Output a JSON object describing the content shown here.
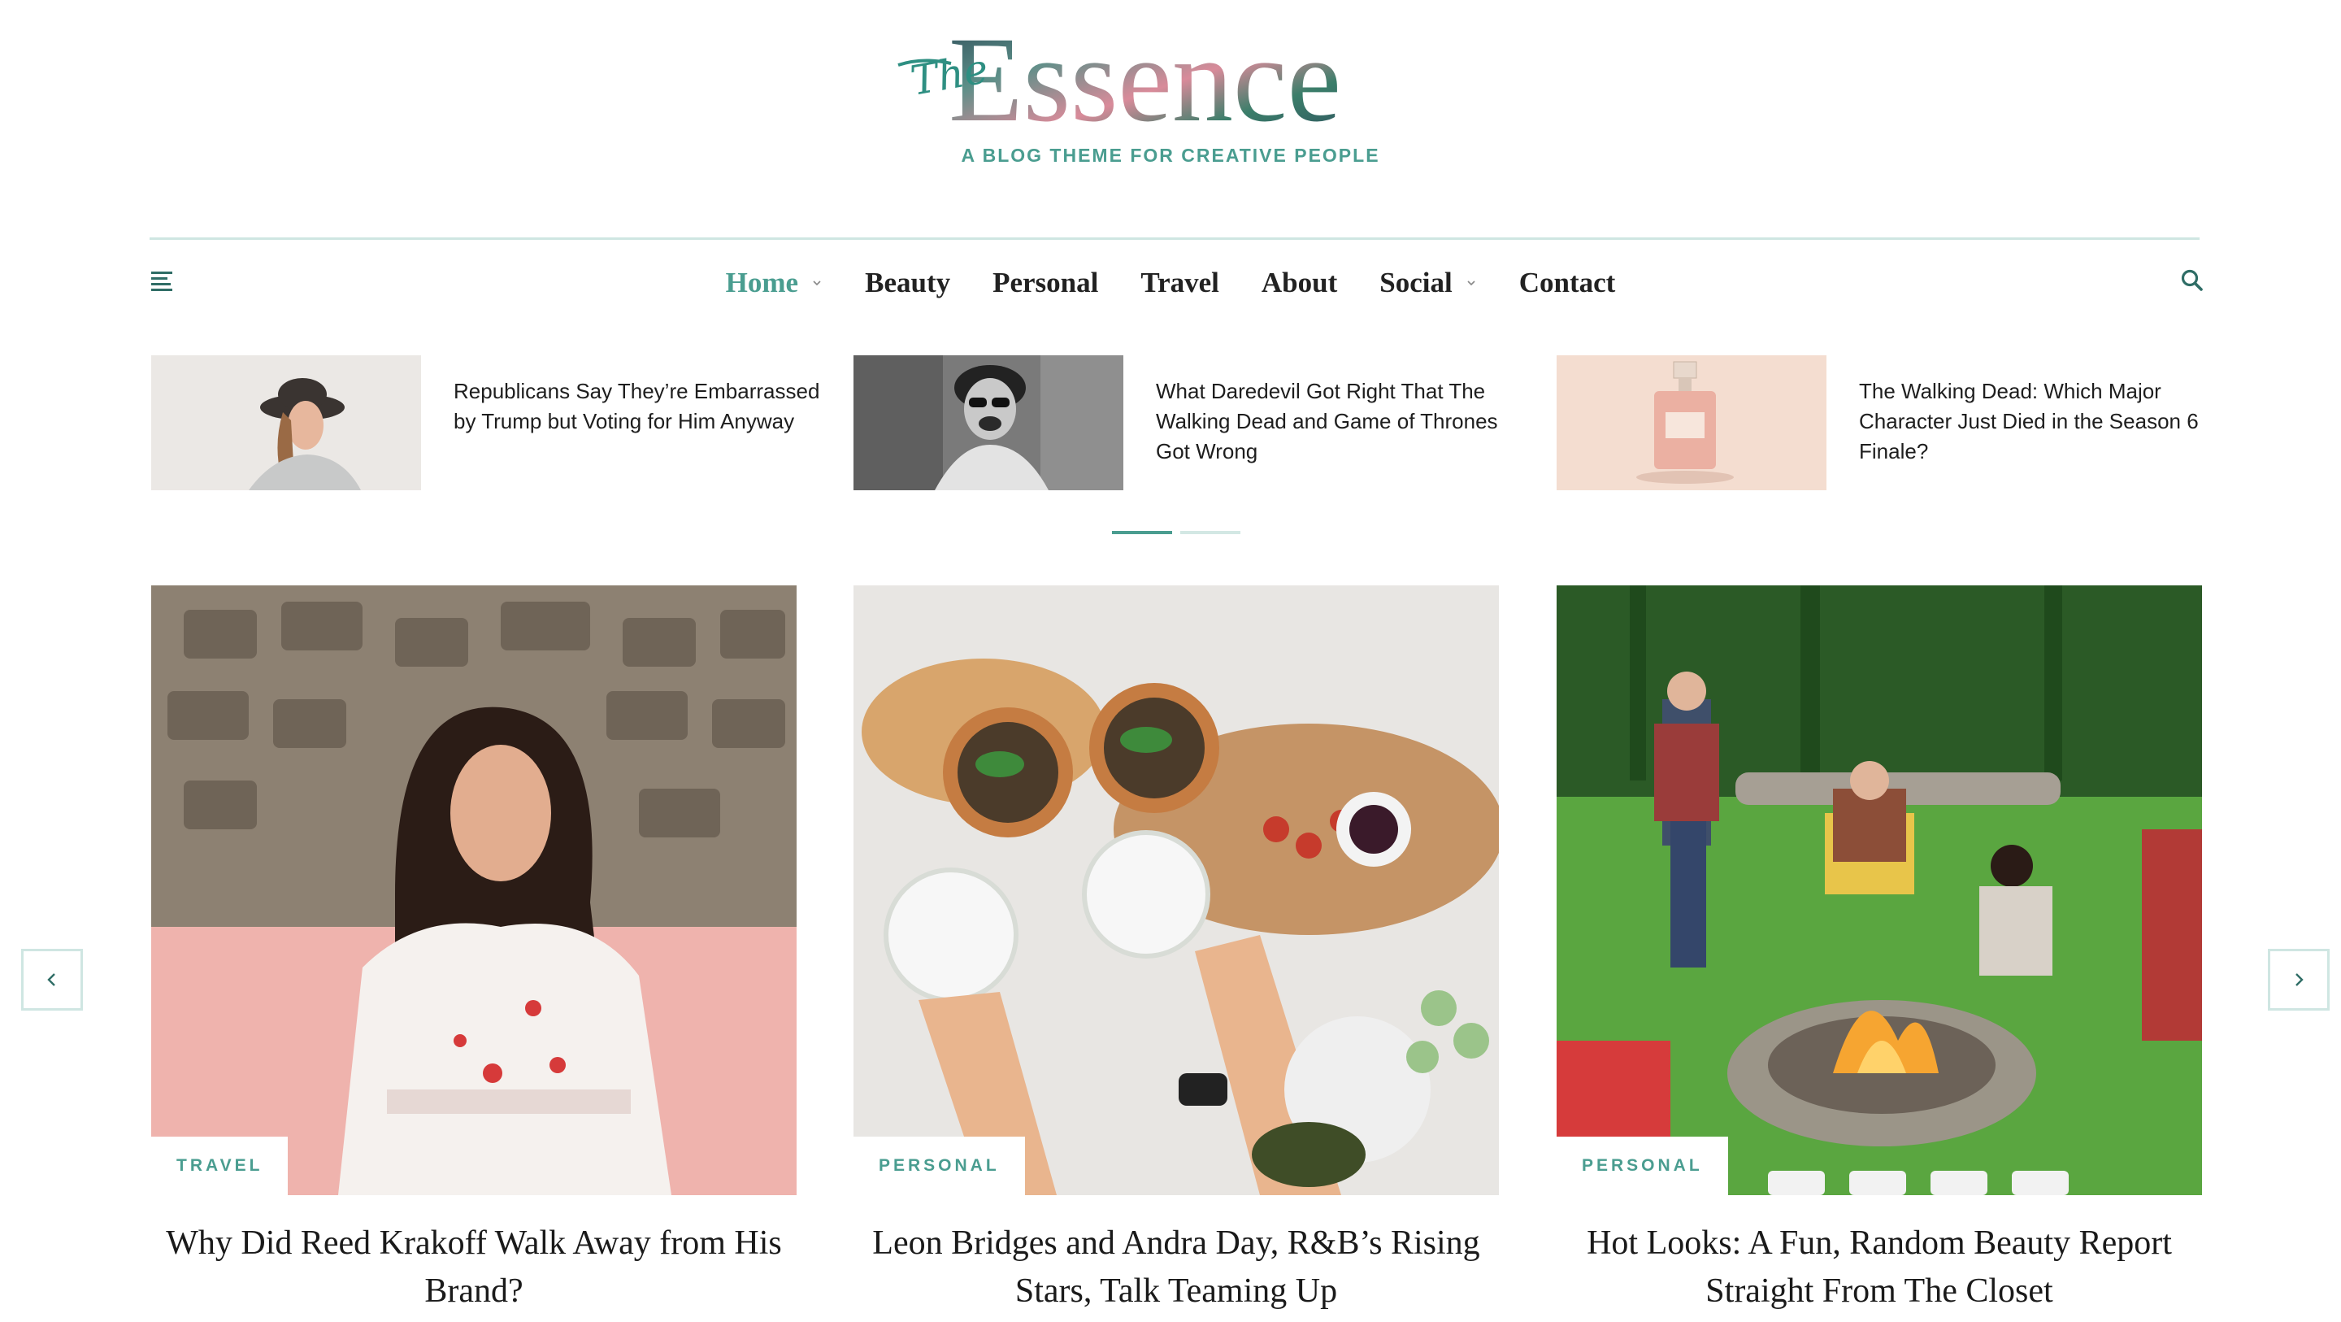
{
  "brand": {
    "logo_the": "The",
    "logo_main": "Essence",
    "tagline": "A BLOG THEME FOR CREATIVE PEOPLE",
    "accent_color": "#4a9d90"
  },
  "nav": {
    "items": [
      {
        "label": "Home",
        "active": true,
        "has_dropdown": true
      },
      {
        "label": "Beauty",
        "active": false,
        "has_dropdown": false
      },
      {
        "label": "Personal",
        "active": false,
        "has_dropdown": false
      },
      {
        "label": "Travel",
        "active": false,
        "has_dropdown": false
      },
      {
        "label": "About",
        "active": false,
        "has_dropdown": false
      },
      {
        "label": "Social",
        "active": false,
        "has_dropdown": true
      },
      {
        "label": "Contact",
        "active": false,
        "has_dropdown": false
      }
    ],
    "menu_icon": "hamburger-icon",
    "search_icon": "search-icon"
  },
  "featured_strip": [
    {
      "title": "Republicans Say They’re Embarrassed by Trump but Voting for Him Anyway",
      "image": "woman-hat-photo"
    },
    {
      "title": "What Daredevil Got Right That The Walking Dead and Game of Thrones Got Wrong",
      "image": "laughing-woman-photo"
    },
    {
      "title": "The Walking Dead: Which Major Character Just Died in the Season 6 Finale?",
      "image": "perfume-bottle-photo"
    }
  ],
  "carousel": {
    "dots": [
      {
        "active": true
      },
      {
        "active": false
      }
    ],
    "prev_icon": "chevron-left-icon",
    "next_icon": "chevron-right-icon"
  },
  "cards": [
    {
      "category": "TRAVEL",
      "title": "Why Did Reed Krakoff Walk Away from His Brand?",
      "image": "woman-floral-dress-photo"
    },
    {
      "category": "PERSONAL",
      "title": "Leon Bridges and Andra Day, R&B’s Rising Stars, Talk Teaming Up",
      "image": "cocktail-toast-photo"
    },
    {
      "category": "PERSONAL",
      "title": "Hot Looks: A Fun, Random Beauty Report Straight From The Closet",
      "image": "campfire-friends-photo"
    }
  ]
}
